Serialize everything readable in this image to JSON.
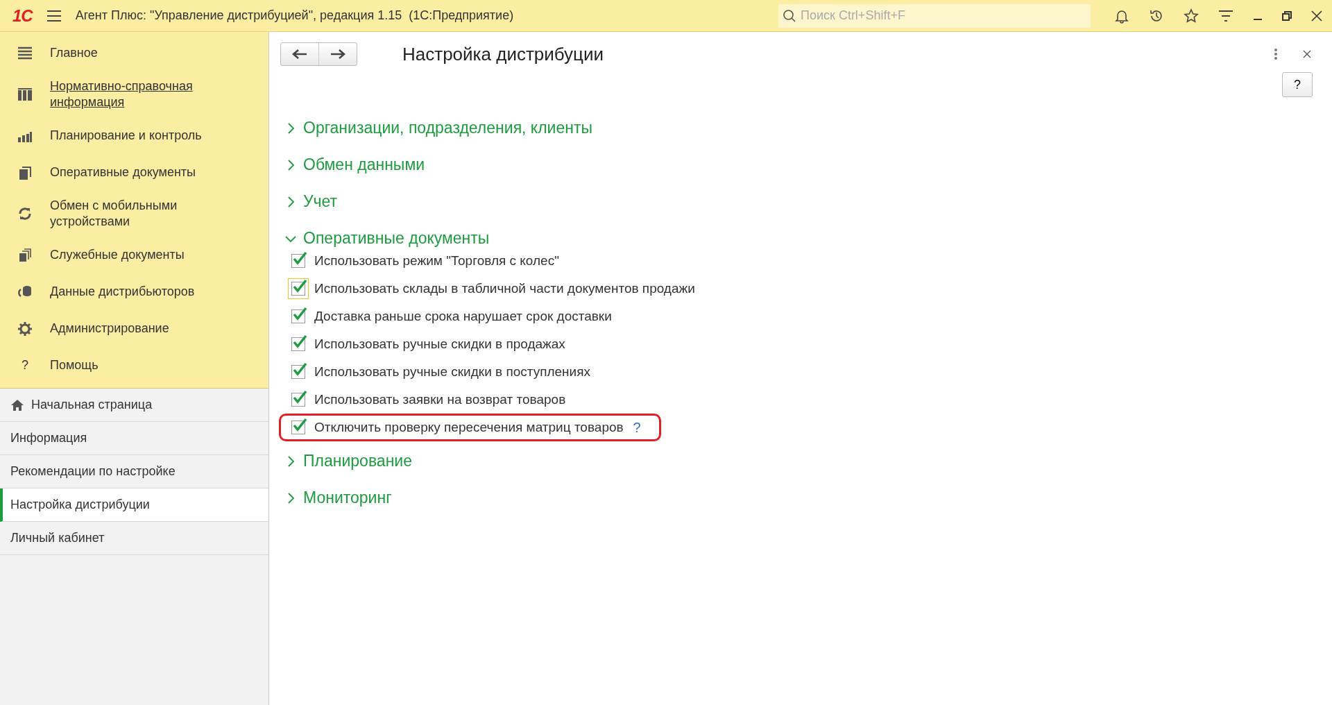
{
  "window": {
    "title": "Агент Плюс: \"Управление дистрибуцией\", редакция 1.15  (1С:Предприятие)"
  },
  "logo": "1С",
  "search": {
    "placeholder": "Поиск Ctrl+Shift+F"
  },
  "sections": [
    {
      "label": "Главное",
      "hovered": false
    },
    {
      "label": "Нормативно-справочная информация",
      "hovered": true
    },
    {
      "label": "Планирование и контроль",
      "hovered": false
    },
    {
      "label": "Оперативные документы",
      "hovered": false
    },
    {
      "label": "Обмен с мобильными устройствами",
      "hovered": false
    },
    {
      "label": "Служебные документы",
      "hovered": false
    },
    {
      "label": "Данные дистрибьюторов",
      "hovered": false
    },
    {
      "label": "Администрирование",
      "hovered": false
    },
    {
      "label": "Помощь",
      "hovered": false,
      "glyph": "?"
    }
  ],
  "open_pages": [
    {
      "label": "Начальная страница",
      "selected": false,
      "kind": "home"
    },
    {
      "label": "Информация",
      "selected": false,
      "kind": "page"
    },
    {
      "label": "Рекомендации по настройке",
      "selected": false,
      "kind": "page"
    },
    {
      "label": "Настройка дистрибуции",
      "selected": true,
      "kind": "page"
    },
    {
      "label": "Личный кабинет",
      "selected": false,
      "kind": "page"
    }
  ],
  "form": {
    "title": "Настройка дистрибуции",
    "help_button": "?",
    "groups": [
      {
        "label": "Организации, подразделения, клиенты",
        "expanded": false
      },
      {
        "label": "Обмен данными",
        "expanded": false
      },
      {
        "label": "Учет",
        "expanded": false
      },
      {
        "label": "Оперативные документы",
        "expanded": true,
        "options": [
          {
            "label": "Использовать режим \"Торговля с колес\"",
            "checked": true,
            "focused": false,
            "highlighted": false
          },
          {
            "label": "Использовать склады в табличной части документов продажи",
            "checked": true,
            "focused": true,
            "highlighted": false
          },
          {
            "label": "Доставка раньше срока нарушает срок доставки",
            "checked": true,
            "focused": false,
            "highlighted": false
          },
          {
            "label": "Использовать ручные скидки в продажах",
            "checked": true,
            "focused": false,
            "highlighted": false
          },
          {
            "label": "Использовать ручные скидки в поступлениях",
            "checked": true,
            "focused": false,
            "highlighted": false
          },
          {
            "label": "Использовать заявки на возврат товаров",
            "checked": true,
            "focused": false,
            "highlighted": false
          },
          {
            "label": "Отключить проверку пересечения матриц товаров",
            "checked": true,
            "focused": false,
            "highlighted": true,
            "help": "?"
          }
        ]
      },
      {
        "label": "Планирование",
        "expanded": false
      },
      {
        "label": "Мониторинг",
        "expanded": false
      }
    ]
  }
}
